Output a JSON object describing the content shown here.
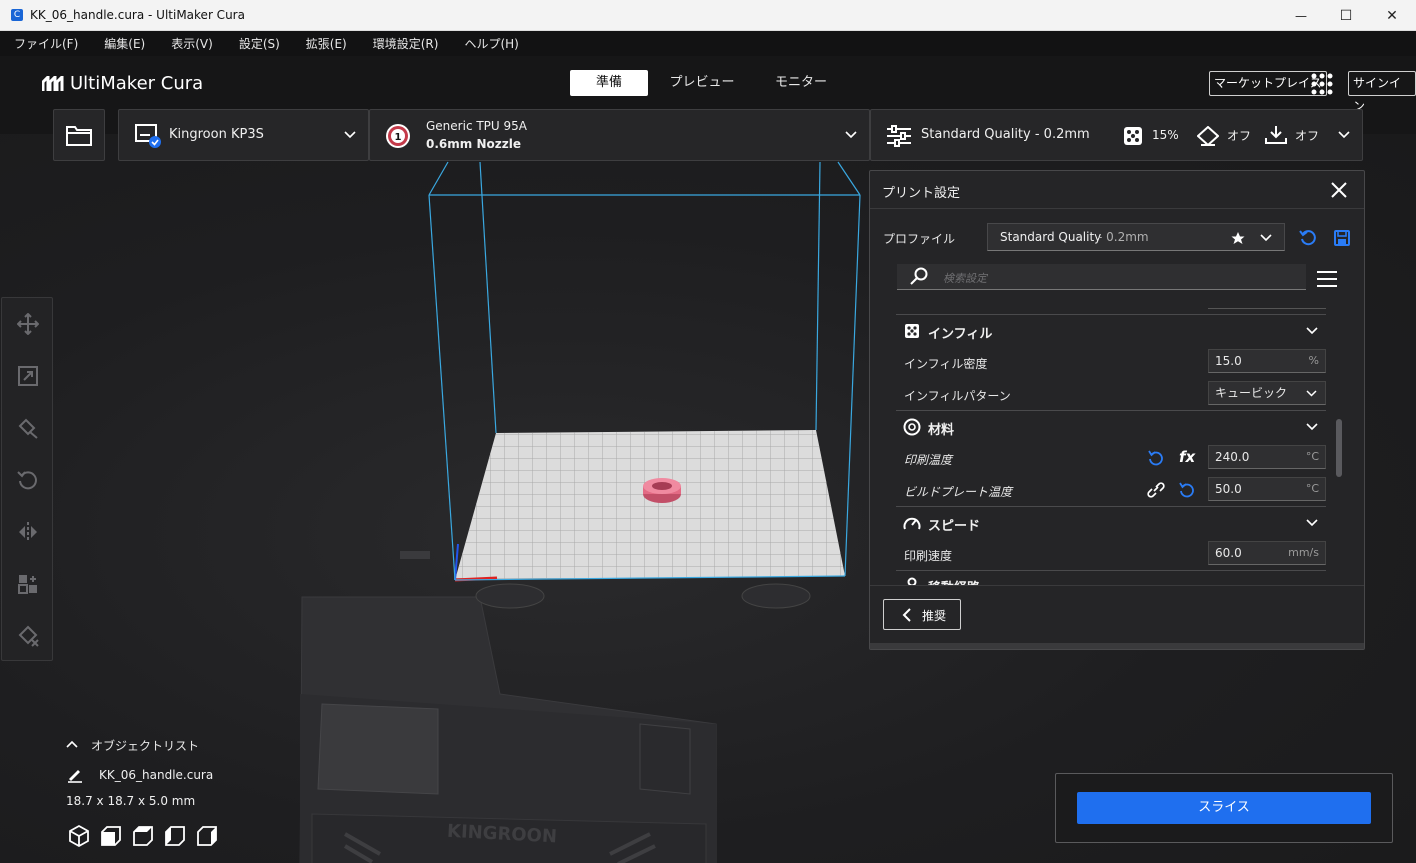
{
  "window": {
    "title": "KK_06_handle.cura - UltiMaker Cura",
    "minimize": "—",
    "maximize": "☐",
    "close": "✕"
  },
  "menu": [
    "ファイル(F)",
    "編集(E)",
    "表示(V)",
    "設定(S)",
    "拡張(E)",
    "環境設定(R)",
    "ヘルプ(H)"
  ],
  "header": {
    "logo": "UltiMaker Cura",
    "tabs": [
      "準備",
      "プレビュー",
      "モニター"
    ],
    "active_tab": "準備",
    "marketplace": "マーケットプレイス",
    "signin": "サインイン"
  },
  "toolbar": {
    "printer": "Kingroon KP3S",
    "material_name": "Generic TPU 95A",
    "nozzle": "0.6mm Nozzle",
    "extruder_number": "1",
    "quality": "Standard Quality - 0.2mm",
    "infill": "15%",
    "support": "オフ",
    "adhesion": "オフ"
  },
  "panel": {
    "title": "プリント設定",
    "profile_label": "プロファイル",
    "profile_value": "Standard Quality",
    "profile_suffix": " - 0.2mm",
    "search_placeholder": "検索設定",
    "cat_infill": "インフィル",
    "infill_density_label": "インフィル密度",
    "infill_density_value": "15.0",
    "infill_density_unit": "%",
    "infill_pattern_label": "インフィルパターン",
    "infill_pattern_value": "キュービック",
    "cat_material": "材料",
    "print_temp_label": "印刷温度",
    "print_temp_value": "240.0",
    "print_temp_unit": "°C",
    "bed_temp_label": "ビルドプレート温度",
    "bed_temp_value": "50.0",
    "bed_temp_unit": "°C",
    "cat_speed": "スピード",
    "print_speed_label": "印刷速度",
    "print_speed_value": "60.0",
    "print_speed_unit": "mm/s",
    "cat_travel": "移動経路",
    "recommended_button": "推奨",
    "fx_icon": "fx"
  },
  "object_list": {
    "header": "オブジェクトリスト",
    "file": "KK_06_handle.cura",
    "dimensions": "18.7 x 18.7 x 5.0 mm"
  },
  "slice_button": "スライス",
  "printer_brand": "KINGROON",
  "colors": {
    "accent": "#1f6fef",
    "model": "#e36a84",
    "frame": "#3aa8e0",
    "background": "#1a1a1b"
  }
}
